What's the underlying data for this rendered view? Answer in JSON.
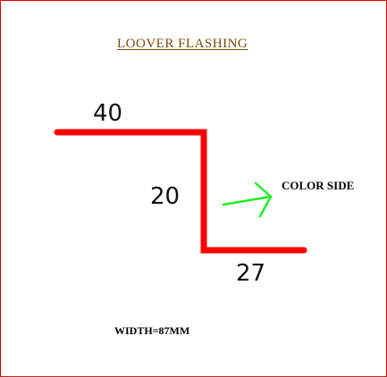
{
  "diagram": {
    "title": "LOOVER FLASHING",
    "dimensions": {
      "top_flange": "40",
      "vertical_web": "20",
      "bottom_flange": "27"
    },
    "color_side_label": "COLOR SIDE",
    "width_label": "WIDTH=87MM",
    "colors": {
      "border": "#e00000",
      "profile": "#ff0000",
      "arrow": "#22ee22",
      "title": "#7a4a0a"
    }
  }
}
